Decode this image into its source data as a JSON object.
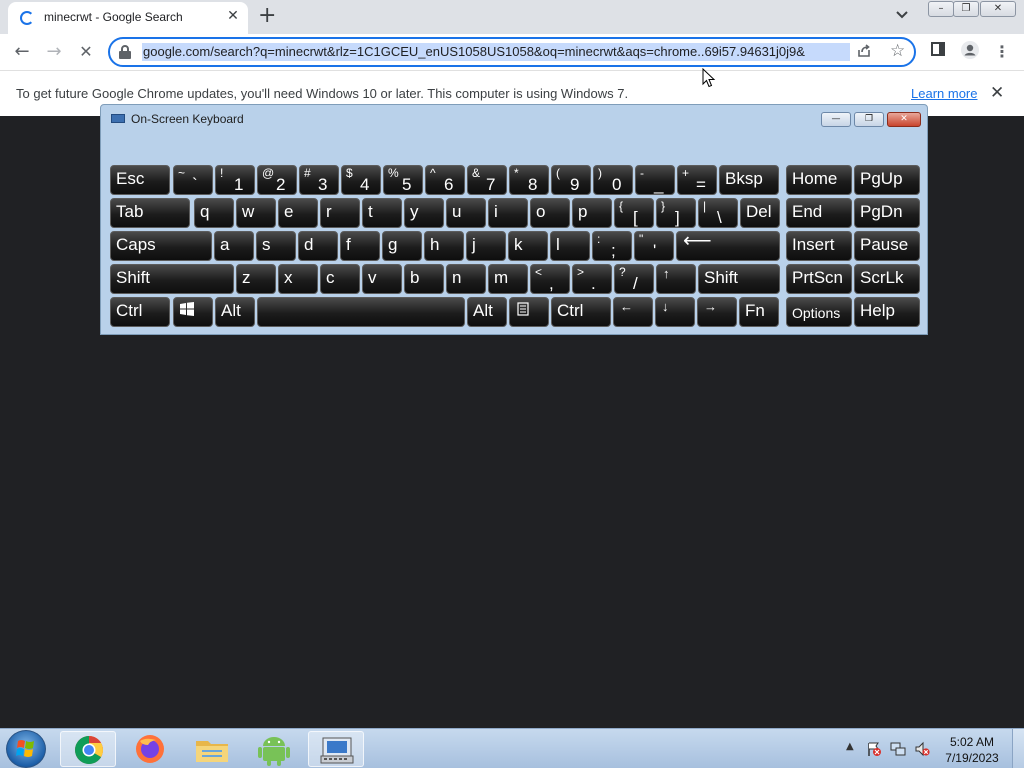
{
  "browser": {
    "tab": {
      "title": "minecrwt - Google Search",
      "close": "✕"
    },
    "new_tab": "+",
    "tab_menu": "❯",
    "window_controls": {
      "minimize": "–",
      "maximize": "❐",
      "close": "✕"
    },
    "nav": {
      "back": "←",
      "forward": "→",
      "reload": "✕"
    },
    "url": "google.com/search?q=minecrwt&rlz=1C1GCEU_enUS1058US1058&oq=minecrwt&aqs=chrome..69i57.94631j0j9&",
    "toolbar_icons": [
      "share-icon",
      "star-icon",
      "side-panel-icon",
      "profile-icon",
      "menu-icon"
    ],
    "infobar": {
      "message": "To get future Google Chrome updates, you'll need Windows 10 or later. This computer is using Windows 7.",
      "link": "Learn more",
      "close": "✕"
    }
  },
  "keyboard": {
    "title": "On-Screen Keyboard",
    "controls": {
      "minimize": "—",
      "restore": "❐",
      "close": "✕"
    },
    "rows": [
      [
        {
          "label": "Esc"
        },
        {
          "shift": "~",
          "char": "`"
        },
        {
          "shift": "!",
          "char": "1"
        },
        {
          "shift": "@",
          "char": "2"
        },
        {
          "shift": "#",
          "char": "3"
        },
        {
          "shift": "$",
          "char": "4"
        },
        {
          "shift": "%",
          "char": "5"
        },
        {
          "shift": "^",
          "char": "6"
        },
        {
          "shift": "&",
          "char": "7"
        },
        {
          "shift": "*",
          "char": "8"
        },
        {
          "shift": "(",
          "char": "9"
        },
        {
          "shift": ")",
          "char": "0"
        },
        {
          "shift": "-",
          "char": "_"
        },
        {
          "shift": "+",
          "char": "="
        },
        {
          "label": "Bksp"
        },
        {
          "label": "Home"
        },
        {
          "label": "PgUp"
        }
      ],
      [
        {
          "label": "Tab"
        },
        {
          "label": "q"
        },
        {
          "label": "w"
        },
        {
          "label": "e"
        },
        {
          "label": "r"
        },
        {
          "label": "t"
        },
        {
          "label": "y"
        },
        {
          "label": "u"
        },
        {
          "label": "i"
        },
        {
          "label": "o"
        },
        {
          "label": "p"
        },
        {
          "shift": "{",
          "char": "["
        },
        {
          "shift": "}",
          "char": "]"
        },
        {
          "shift": "|",
          "char": "\\"
        },
        {
          "label": "Del"
        },
        {
          "label": "End"
        },
        {
          "label": "PgDn"
        }
      ],
      [
        {
          "label": "Caps"
        },
        {
          "label": "a"
        },
        {
          "label": "s"
        },
        {
          "label": "d"
        },
        {
          "label": "f"
        },
        {
          "label": "g"
        },
        {
          "label": "h"
        },
        {
          "label": "j"
        },
        {
          "label": "k"
        },
        {
          "label": "l"
        },
        {
          "shift": ":",
          "char": ";"
        },
        {
          "shift": "\"",
          "char": "'"
        },
        {
          "label": "⟵"
        },
        {
          "label": "Insert"
        },
        {
          "label": "Pause"
        }
      ],
      [
        {
          "label": "Shift"
        },
        {
          "label": "z"
        },
        {
          "label": "x"
        },
        {
          "label": "c"
        },
        {
          "label": "v"
        },
        {
          "label": "b"
        },
        {
          "label": "n"
        },
        {
          "label": "m"
        },
        {
          "shift": "<",
          "char": ","
        },
        {
          "shift": ">",
          "char": "."
        },
        {
          "shift": "?",
          "char": "/"
        },
        {
          "label": "↑"
        },
        {
          "label": "Shift"
        },
        {
          "label": "PrtScn"
        },
        {
          "label": "ScrLk"
        }
      ],
      [
        {
          "label": "Ctrl"
        },
        {
          "icon": "windows-logo-icon"
        },
        {
          "label": "Alt"
        },
        {
          "label": ""
        },
        {
          "label": "Alt"
        },
        {
          "icon": "context-menu-icon"
        },
        {
          "label": "Ctrl"
        },
        {
          "label": "←"
        },
        {
          "label": "↓"
        },
        {
          "label": "→"
        },
        {
          "label": "Fn"
        },
        {
          "label": "Options"
        },
        {
          "label": "Help"
        }
      ]
    ]
  },
  "taskbar": {
    "apps": [
      "chrome-icon",
      "firefox-icon",
      "file-explorer-icon",
      "android-icon",
      "on-screen-keyboard-icon"
    ],
    "tray_arrow": "▲",
    "clock_time": "5:02 AM",
    "clock_date": "7/19/2023"
  }
}
